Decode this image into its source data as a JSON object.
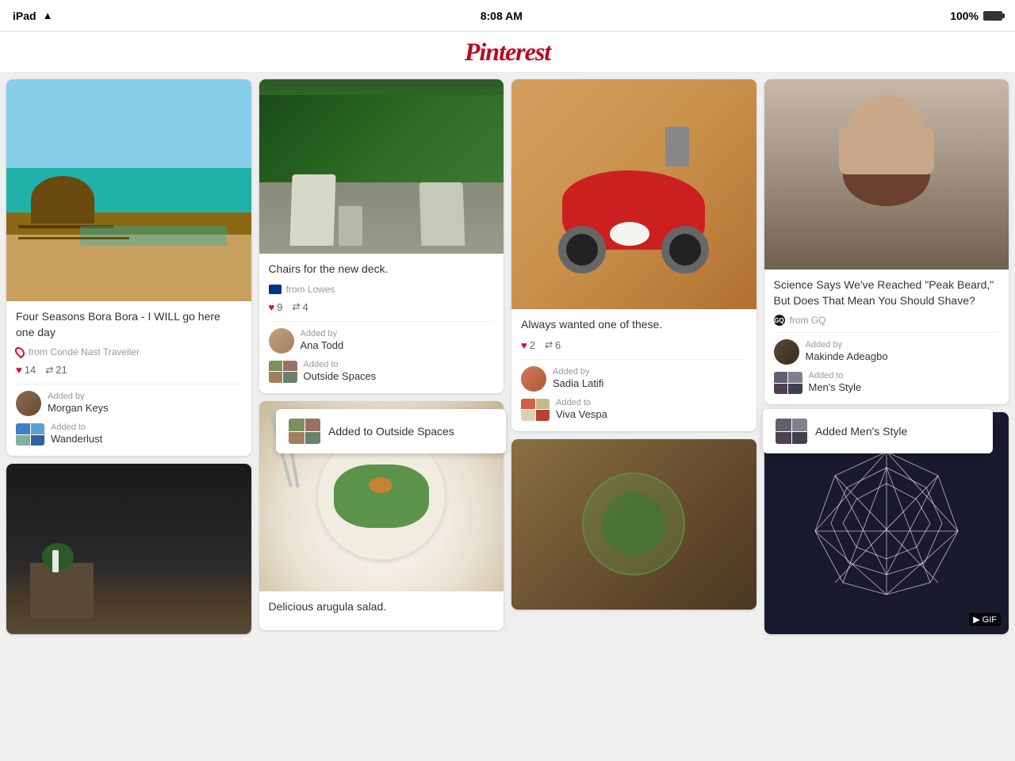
{
  "statusBar": {
    "device": "iPad",
    "wifi": "wifi",
    "time": "8:08 AM",
    "battery": "100%"
  },
  "header": {
    "logo": "Pinterest"
  },
  "pins": [
    {
      "id": "bora-bora",
      "title": "Four Seasons Bora Bora - I WILL go here one day",
      "source": "from Condé Nast Traveller",
      "sourceType": "location",
      "likes": 14,
      "repins": 21,
      "addedBy": "Added by",
      "userName": "Morgan Keys",
      "addedTo": "Added to",
      "boardName": "Wanderlust"
    },
    {
      "id": "chairs",
      "title": "Chairs for the new deck.",
      "source": "from Lowes",
      "sourceType": "lowes",
      "likes": 9,
      "repins": 4,
      "addedBy": "Added by",
      "userName": "Ana Todd",
      "addedTo": "Added to",
      "boardName": "Outside Spaces"
    },
    {
      "id": "scooter",
      "title": "Always wanted one of these.",
      "likes": 2,
      "repins": 6,
      "addedBy": "Added by",
      "userName": "Sadia Latifi",
      "addedTo": "Added to",
      "boardName": "Viva Vespa"
    },
    {
      "id": "beard",
      "title": "Science Says We've Reached \"Peak Beard,\" But Does That Mean You Should Shave?",
      "source": "from GQ",
      "sourceType": "gq",
      "addedBy": "Added by",
      "userName": "Makinde Adeagbo",
      "addedTo": "Added to",
      "boardName": "Men's Style"
    },
    {
      "id": "furniture",
      "title": ""
    },
    {
      "id": "salad",
      "title": "Delicious arugula salad."
    },
    {
      "id": "terrarium",
      "title": ""
    },
    {
      "id": "geometric",
      "title": "",
      "gif": "GIF"
    }
  ],
  "toasts": [
    {
      "id": "toast-outside",
      "text": "Added to Outside Spaces"
    },
    {
      "id": "toast-mens",
      "text": "Added Men's Style"
    }
  ]
}
